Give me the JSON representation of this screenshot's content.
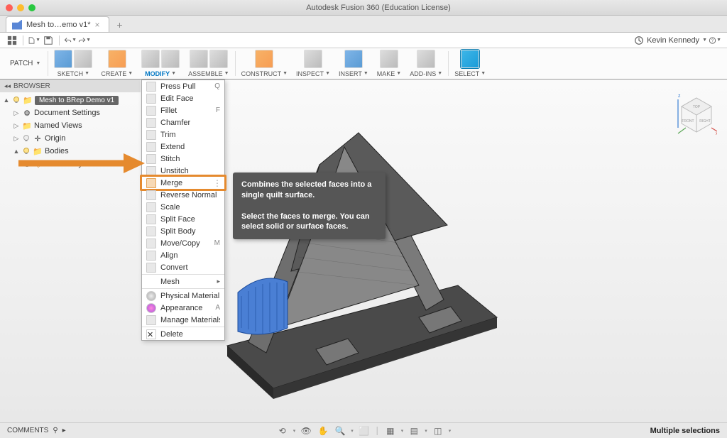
{
  "window": {
    "title": "Autodesk Fusion 360 (Education License)"
  },
  "tab": {
    "label": "Mesh to…emo v1*"
  },
  "account": {
    "user": "Kevin Kennedy"
  },
  "mode": {
    "label": "PATCH"
  },
  "ribbon": {
    "sketch": "SKETCH",
    "create": "CREATE",
    "modify": "MODIFY",
    "assemble": "ASSEMBLE",
    "construct": "CONSTRUCT",
    "inspect": "INSPECT",
    "insert": "INSERT",
    "make": "MAKE",
    "addins": "ADD-INS",
    "select": "SELECT"
  },
  "browser": {
    "heading": "BROWSER",
    "root": "Mesh to BRep Demo v1",
    "settings": "Document Settings",
    "named": "Named Views",
    "origin": "Origin",
    "bodies": "Bodies",
    "mesh": "MeshBody1"
  },
  "menu": {
    "press_pull": "Press Pull",
    "press_pull_sc": "Q",
    "edit_face": "Edit Face",
    "fillet": "Fillet",
    "fillet_sc": "F",
    "chamfer": "Chamfer",
    "trim": "Trim",
    "extend": "Extend",
    "stitch": "Stitch",
    "unstitch": "Unstitch",
    "merge": "Merge",
    "reverse": "Reverse Normal",
    "scale": "Scale",
    "split_face": "Split Face",
    "split_body": "Split Body",
    "move": "Move/Copy",
    "move_sc": "M",
    "align": "Align",
    "convert": "Convert",
    "mesh": "Mesh",
    "material": "Physical Material",
    "appearance": "Appearance",
    "appearance_sc": "A",
    "manage": "Manage Materials",
    "delete": "Delete"
  },
  "tooltip": {
    "line1": "Combines the selected faces into a single quilt surface.",
    "line2": "Select the faces to merge. You can select solid or surface faces."
  },
  "status": {
    "comments": "COMMENTS",
    "selection": "Multiple selections"
  }
}
